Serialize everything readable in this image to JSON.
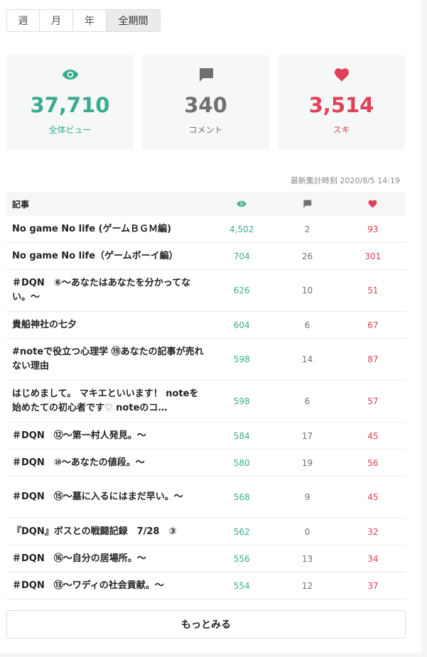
{
  "tabs": [
    {
      "label": "週"
    },
    {
      "label": "月"
    },
    {
      "label": "年"
    },
    {
      "label": "全期間",
      "active": true
    }
  ],
  "summary": {
    "views": {
      "value": "37,710",
      "label": "全体ビュー",
      "icon": "eye-icon",
      "color": "#3bab90"
    },
    "comments": {
      "value": "340",
      "label": "コメント",
      "icon": "comment-icon",
      "color": "#707070"
    },
    "likes": {
      "value": "3,514",
      "label": "スキ",
      "icon": "heart-icon",
      "color": "#e0405a"
    }
  },
  "timestamp": "最新集計時刻 2020/8/5 14:19",
  "table": {
    "header": {
      "title": "記事"
    },
    "rows": [
      {
        "title": "No game No life (ゲームＢＧＭ編)",
        "views": "4,502",
        "comments": "2",
        "likes": "93"
      },
      {
        "title": "No game No life（ゲームボーイ編）",
        "views": "704",
        "comments": "26",
        "likes": "301"
      },
      {
        "title": "＃DQN　⑥～あなたはあなたを分かってない。～",
        "views": "626",
        "comments": "10",
        "likes": "51"
      },
      {
        "title": "貴船神社の七夕",
        "views": "604",
        "comments": "6",
        "likes": "67"
      },
      {
        "title": "#noteで役立つ心理学 ⑲あなたの記事が売れない理由",
        "views": "598",
        "comments": "14",
        "likes": "87"
      },
      {
        "title": "はじめまして。 マキエといいます！ noteを始めたての初心者です♡ noteのコ…",
        "views": "598",
        "comments": "6",
        "likes": "57"
      },
      {
        "title": "＃DQN　⑫～第一村人発見。～",
        "views": "584",
        "comments": "17",
        "likes": "45"
      },
      {
        "title": "＃DQN　⑩～あなたの値段。～",
        "views": "580",
        "comments": "19",
        "likes": "56"
      },
      {
        "title": "＃DQN　⑮～墓に入るにはまだ早い。～",
        "views": "568",
        "comments": "9",
        "likes": "45"
      },
      {
        "title": "『DQN』ボスとの戦闘記録　7/28　③",
        "views": "562",
        "comments": "0",
        "likes": "32"
      },
      {
        "title": "＃DQN　⑯～自分の居場所。～",
        "views": "556",
        "comments": "13",
        "likes": "34"
      },
      {
        "title": "＃DQN　⑬～ワディの社会貢献。～",
        "views": "554",
        "comments": "12",
        "likes": "37"
      }
    ]
  },
  "more_button": {
    "label": "もっとみる"
  }
}
